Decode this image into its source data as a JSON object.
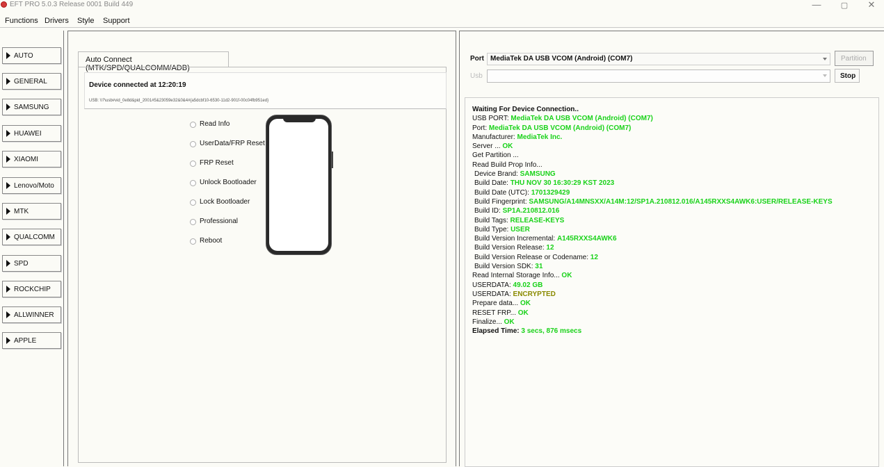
{
  "window": {
    "title": "EFT PRO 5.0.3 Release 0001 Build 449",
    "controls": {
      "minimize": "—",
      "maximize": "▢",
      "close": "✕"
    }
  },
  "menu": [
    "Functions",
    "Drivers",
    "Style",
    "Support"
  ],
  "sidebar": {
    "items": [
      {
        "label": "AUTO"
      },
      {
        "label": "GENERAL"
      },
      {
        "label": "SAMSUNG"
      },
      {
        "label": "HUAWEI"
      },
      {
        "label": "XIAOMI"
      },
      {
        "label": "Lenovo/Moto"
      },
      {
        "label": "MTK"
      },
      {
        "label": "QUALCOMM"
      },
      {
        "label": "SPD"
      },
      {
        "label": "ROCKCHIP"
      },
      {
        "label": "ALLWINNER"
      },
      {
        "label": "APPLE"
      }
    ]
  },
  "center": {
    "tab_label": "Auto Connect (MTK/SPD/QUALCOMM/ADB)",
    "device_connected": "Device connected at 12:20:19",
    "usb_path": "USB: \\\\?\\usb#vid_0e8d&pid_2001#5&23059e32&0&4#{a5dcbf10-6530-11d2-901f-00c04fb951ed}",
    "options": [
      {
        "label": "Read Info"
      },
      {
        "label": "UserData/FRP Reset"
      },
      {
        "label": "FRP Reset"
      },
      {
        "label": "Unlock Bootloader"
      },
      {
        "label": "Lock Bootloader"
      },
      {
        "label": "Professional"
      },
      {
        "label": "Reboot"
      }
    ]
  },
  "right": {
    "port_label": "Port",
    "port_value": "MediaTek DA USB VCOM (Android) (COM7)",
    "partition_button": "Partition",
    "usb_label": "Usb",
    "usb_value": "",
    "stop_button": "Stop",
    "colors": {
      "green": "#19d219",
      "olive": "#8a8a00"
    },
    "log": [
      {
        "label": "Waiting For Device Connection..",
        "value": "",
        "bold": true
      },
      {
        "label": "USB PORT: ",
        "value": "MediaTek DA USB VCOM (Android) (COM7)",
        "color": "green"
      },
      {
        "label": "Port: ",
        "value": "MediaTek DA USB VCOM (Android) (COM7)",
        "color": "green"
      },
      {
        "label": "Manufacturer: ",
        "value": "MediaTek Inc.",
        "color": "green"
      },
      {
        "label": "Server ... ",
        "value": "OK",
        "color": "green"
      },
      {
        "label": "Get Partition ...",
        "value": ""
      },
      {
        "label": "Read Build Prop Info...",
        "value": ""
      },
      {
        "label": "Device Brand: ",
        "value": "SAMSUNG",
        "color": "green",
        "indent": true
      },
      {
        "label": "Build Date: ",
        "value": "THU NOV 30 16:30:29 KST 2023",
        "color": "green",
        "indent": true
      },
      {
        "label": "Build Date (UTC): ",
        "value": "1701329429",
        "color": "green",
        "indent": true
      },
      {
        "label": "Build Fingerprint: ",
        "value": "SAMSUNG/A14MNSXX/A14M:12/SP1A.210812.016/A145RXXS4AWK6:USER/RELEASE-KEYS",
        "color": "green",
        "indent": true
      },
      {
        "label": "Build ID: ",
        "value": "SP1A.210812.016",
        "color": "green",
        "indent": true
      },
      {
        "label": "Build Tags: ",
        "value": "RELEASE-KEYS",
        "color": "green",
        "indent": true
      },
      {
        "label": "Build Type: ",
        "value": "USER",
        "color": "green",
        "indent": true
      },
      {
        "label": "Build Version Incremental: ",
        "value": "A145RXXS4AWK6",
        "color": "green",
        "indent": true
      },
      {
        "label": "Build Version Release: ",
        "value": "12",
        "color": "green",
        "indent": true
      },
      {
        "label": "Build Version Release or Codename: ",
        "value": "12",
        "color": "green",
        "indent": true
      },
      {
        "label": "Build Version SDK: ",
        "value": "31",
        "color": "green",
        "indent": true
      },
      {
        "label": "Read Internal Storage Info... ",
        "value": "OK",
        "color": "green"
      },
      {
        "label": "USERDATA: ",
        "value": "49.02 GB",
        "color": "green"
      },
      {
        "label": "USERDATA: ",
        "value": "ENCRYPTED",
        "color": "olive"
      },
      {
        "label": "Prepare data... ",
        "value": "OK",
        "color": "green"
      },
      {
        "label": "RESET FRP... ",
        "value": "OK",
        "color": "green"
      },
      {
        "label": "Finalize... ",
        "value": "OK",
        "color": "green"
      },
      {
        "label": "Elapsed Time: ",
        "value": "3 secs, 876 msecs",
        "color": "green",
        "bold": true
      }
    ]
  }
}
